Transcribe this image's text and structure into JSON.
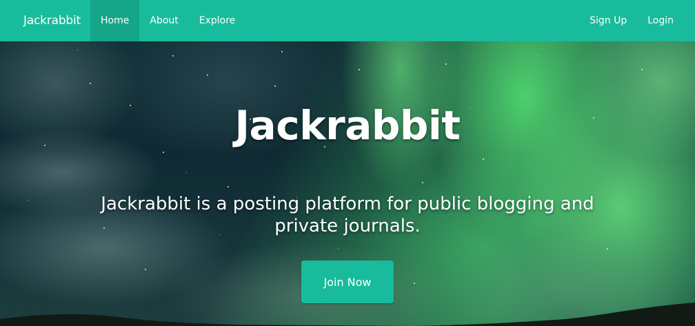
{
  "navbar": {
    "brand": "Jackrabbit",
    "left_items": [
      {
        "label": "Home",
        "active": true
      },
      {
        "label": "About",
        "active": false
      },
      {
        "label": "Explore",
        "active": false
      }
    ],
    "right_items": [
      {
        "label": "Sign Up"
      },
      {
        "label": "Login"
      }
    ],
    "accent_color": "#18bc9c",
    "active_color": "#15a589"
  },
  "hero": {
    "title": "Jackrabbit",
    "tagline": "Jackrabbit is a posting platform for public blogging and private journals.",
    "cta_label": "Join Now",
    "background": "aurora-night-sky"
  }
}
